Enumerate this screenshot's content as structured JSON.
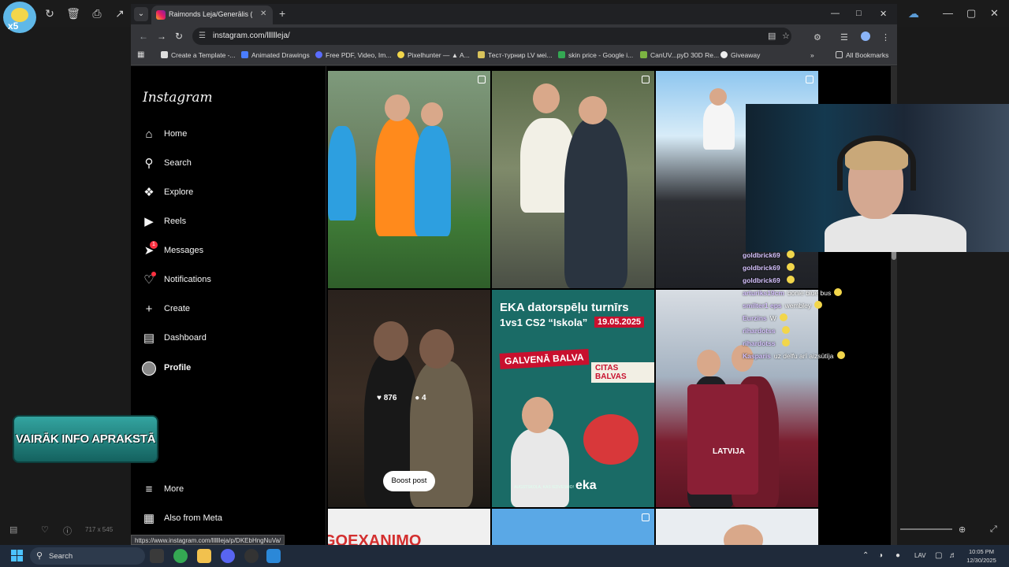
{
  "viewer": {
    "zoom_badge": "x5",
    "dims": "717 x 545"
  },
  "browser": {
    "tab_title": "Raimonds Leja/Generālis (@lllll",
    "url": "instagram.com/lllllleja/",
    "status_url": "https://www.instagram.com/lllllleja/p/DKEbHngNuVa/",
    "bookmarks": [
      "Create a Template -...",
      "Animated Drawings",
      "Free PDF, Video, Im...",
      "Pixelhunter — ▲ A...",
      "Тест-турнир LV меi...",
      "skin price - Google i...",
      "CanUV...pyD 30D Re...",
      "Giveaway"
    ],
    "all_bookmarks": "All Bookmarks"
  },
  "instagram": {
    "logo": "Instagram",
    "nav": [
      {
        "label": "Home"
      },
      {
        "label": "Search"
      },
      {
        "label": "Explore"
      },
      {
        "label": "Reels"
      },
      {
        "label": "Messages",
        "badge": "1"
      },
      {
        "label": "Notifications"
      },
      {
        "label": "Create"
      },
      {
        "label": "Dashboard"
      },
      {
        "label": "Profile"
      }
    ],
    "more": "More",
    "also_from_meta": "Also from Meta",
    "hover_post": {
      "likes": "876",
      "comments": "4",
      "boost_label": "Boost post"
    },
    "eka_post": {
      "title": "EKA datorspēļu turnīrs",
      "subtitle": "1vs1 CS2 “Iskola”",
      "date": "19.05.2025",
      "main_prize": "GALVENĀ BALVA",
      "other_prizes": "CITAS BALVAS",
      "logo": "eka",
      "school": "AUGSTSKOLA, KAS IEDVESMO!"
    },
    "latvija_post": {
      "jersey_text": "LATVIJA"
    },
    "bottom_post_text": "GOEXANIMO"
  },
  "banner": {
    "text": "VAIRĀK INFO APRAKSTĀ"
  },
  "chat": [
    {
      "user": "goldbrick69",
      "msg": ""
    },
    {
      "user": "goldbrick69",
      "msg": ""
    },
    {
      "user": "goldbrick69",
      "msg": ""
    },
    {
      "user": "arturiks19cm",
      "msg": "bonie blue bus"
    },
    {
      "user": "smilter1 eps",
      "msg": "wembley"
    },
    {
      "user": "Eurzins",
      "msg": "W"
    },
    {
      "user": "rihardotss",
      "msg": ""
    },
    {
      "user": "rihardotss",
      "msg": ""
    },
    {
      "user": "Kasparis",
      "msg": "uz delfu arī aizsūtīja"
    }
  ],
  "taskbar": {
    "search_label": "Search",
    "lang": "LAV",
    "time": "10:05 PM",
    "date": "12/30/2025"
  }
}
